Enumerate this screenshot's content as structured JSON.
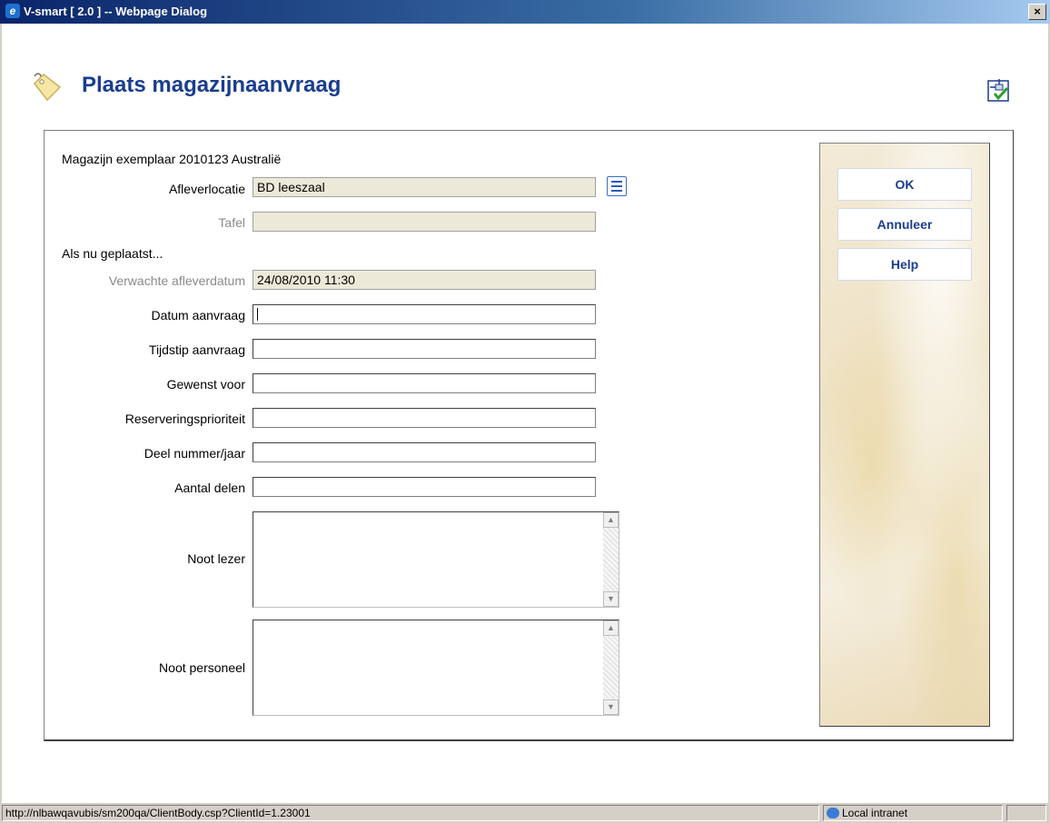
{
  "window": {
    "title": "V-smart [ 2.0 ] -- Webpage Dialog",
    "close_label": "×"
  },
  "page": {
    "title": "Plaats magazijnaanvraag"
  },
  "form": {
    "item_line": "Magazijn exemplaar 2010123 Australië",
    "delivery_location_label": "Afleverlocatie",
    "delivery_location_value": "BD leeszaal",
    "table_label": "Tafel",
    "table_value": "",
    "if_placed_now": "Als nu geplaatst...",
    "expected_delivery_label": "Verwachte afleverdatum",
    "expected_delivery_value": "24/08/2010 11:30",
    "request_date_label": "Datum aanvraag",
    "request_time_label": "Tijdstip aanvraag",
    "wanted_for_label": "Gewenst voor",
    "priority_label": "Reserveringsprioriteit",
    "part_label": "Deel nummer/jaar",
    "parts_count_label": "Aantal delen",
    "reader_note_label": "Noot lezer",
    "staff_note_label": "Noot personeel"
  },
  "buttons": {
    "ok": "OK",
    "cancel": "Annuleer",
    "help": "Help"
  },
  "status": {
    "url": "http://nlbawqavubis/sm200qa/ClientBody.csp?ClientId=1.23001",
    "zone": "Local intranet"
  },
  "icons": {
    "tag": "tag-icon",
    "confirm": "tree-check-icon",
    "list": "list-icon"
  }
}
